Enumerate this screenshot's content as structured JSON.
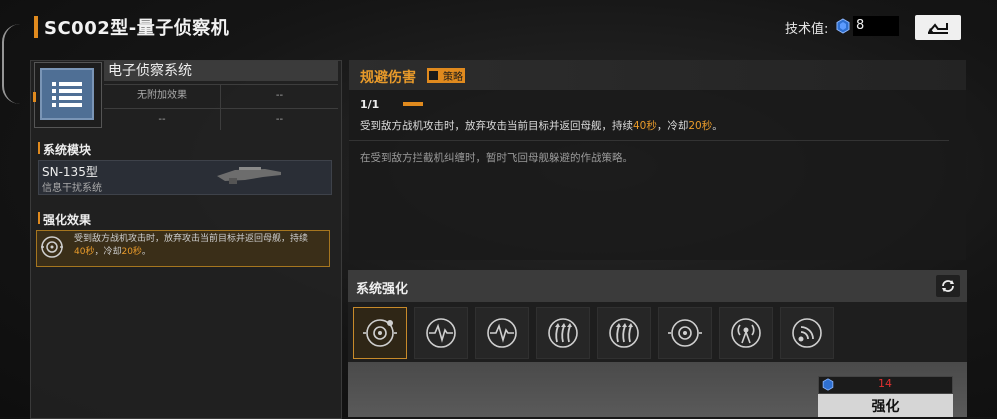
{
  "header": {
    "title": "SC002型-量子侦察机",
    "tech_label": "技术值:",
    "tech_value": "8"
  },
  "left_panel": {
    "system_name": "电子侦察系统",
    "grid": [
      "无附加效果",
      "--",
      "--",
      "--"
    ],
    "module_section": "系统模块",
    "module_name": "SN-135型",
    "module_sub": "信息干扰系统",
    "effect_section": "强化效果",
    "effect_text_1": "受到敌方战机攻击时，放弃攻击当前目标并返回母舰，持续",
    "effect_text_2a": "40秒",
    "effect_text_2b": "，冷却",
    "effect_text_2c": "20秒",
    "effect_text_2d": "。"
  },
  "info_panel": {
    "skill_title": "规避伤害",
    "badge": "策略",
    "level": "1/1",
    "desc_a": "受到敌方战机攻击时，放弃攻击当前目标并返回母舰，持续",
    "desc_b": "40秒",
    "desc_c": "，冷却",
    "desc_d": "20秒",
    "desc_e": "。",
    "lore": "在受到敌方拦截机纠缠时，暂时飞回母舰躲避的作战策略。"
  },
  "enhance": {
    "title": "系统强化",
    "slots": [
      "evade-target-icon",
      "heartbeat-icon",
      "heartbeat-icon",
      "heat-arrows-icon",
      "heat-arrows-icon",
      "evade-target-icon",
      "radar-tower-icon",
      "signal-wave-icon"
    ],
    "cost": "14",
    "button": "强化"
  },
  "colors": {
    "accent": "#e08a1e",
    "cost_red": "#e03030"
  }
}
